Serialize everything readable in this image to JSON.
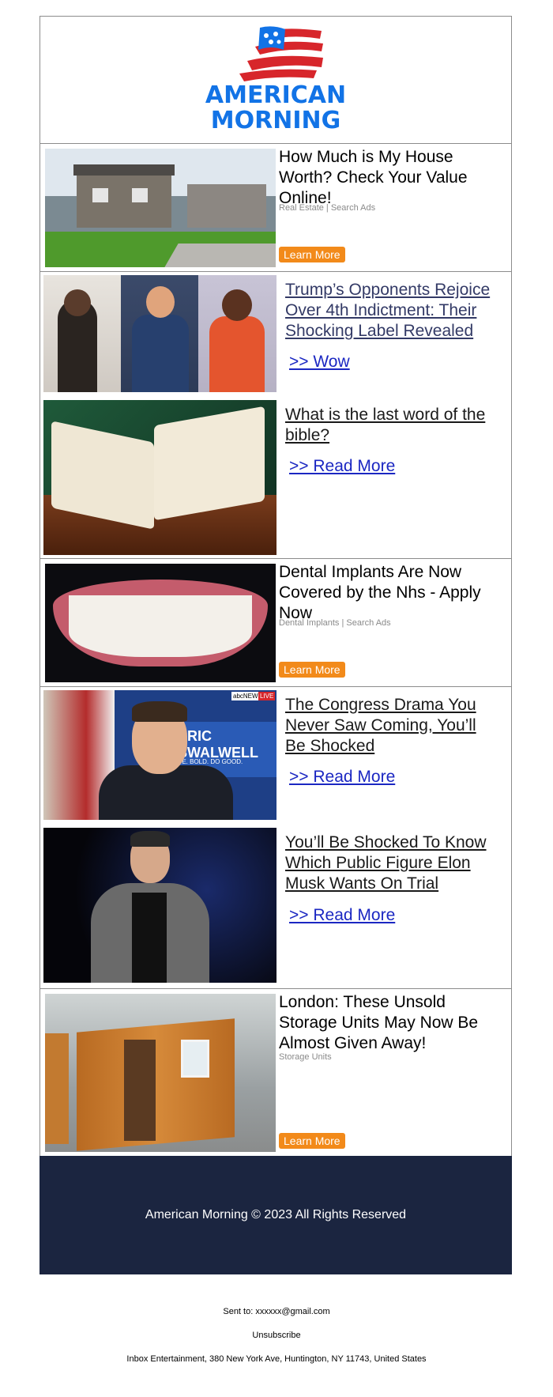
{
  "brand": {
    "line1": "AMERICAN",
    "line2": "MORNING"
  },
  "ads": [
    {
      "title": "How Much is My House Worth? Check Your Value Online!",
      "tag": "Real Estate | Search Ads",
      "button": "Learn More"
    },
    {
      "title": "Dental Implants Are Now Covered by the Nhs - Apply Now",
      "tag": "Dental Implants | Search Ads",
      "button": "Learn More"
    },
    {
      "title": "London: These Unsold Storage Units May Now Be Almost Given Away!",
      "tag": "Storage Units",
      "button": "Learn More"
    }
  ],
  "articles": [
    {
      "title": "Trump’s Opponents Rejoice Over 4th Indictment: Their Shocking Label Revealed",
      "link": ">> Wow"
    },
    {
      "title": "What is the last word of the bible?",
      "link": ">> Read More"
    },
    {
      "title": "The Congress Drama You Never Saw Coming, You’ll Be Shocked",
      "link": ">> Read More",
      "overlay": {
        "network": "abcNEWS",
        "live": "LIVE",
        "sign": "ERIC SWALWELL",
        "slogan": "BE. BOLD. DO GOOD."
      }
    },
    {
      "title": "You’ll Be Shocked To Know Which Public Figure Elon Musk Wants On Trial",
      "link": ">> Read More"
    }
  ],
  "footer": {
    "copyright": "American Morning © 2023 All Rights Reserved",
    "sent_to": "Sent to: xxxxxx@gmail.com",
    "unsubscribe": "Unsubscribe",
    "address": "Inbox Entertainment, 380 New York Ave, Huntington, NY 11743, United States"
  },
  "colors": {
    "brand_blue": "#1273e6",
    "flag_red": "#d7262b",
    "button_orange": "#f28a1a",
    "footer_bg": "#1b2540",
    "link_blue": "#1b27c2"
  }
}
